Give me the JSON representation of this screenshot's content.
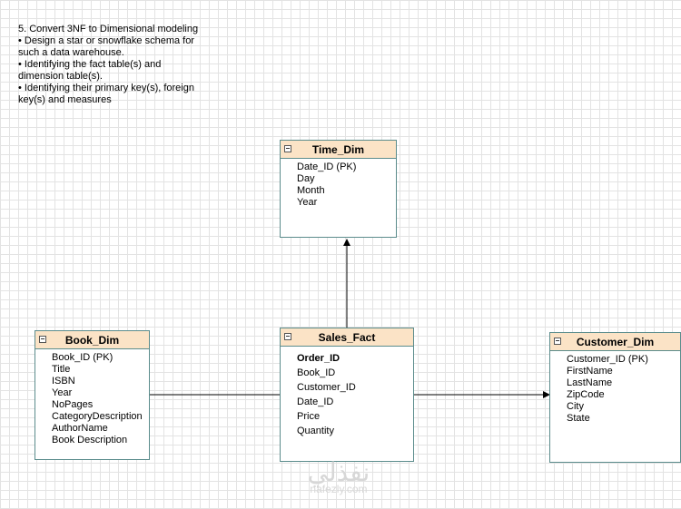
{
  "task": {
    "lines": [
      "5. Convert 3NF to Dimensional modeling",
      "• Design a star or snowflake schema for such a data warehouse.",
      "• Identifying the fact table(s) and dimension table(s).",
      "• Identifying their primary key(s), foreign key(s) and measures"
    ]
  },
  "entities": {
    "time": {
      "title": "Time_Dim",
      "attributes": [
        "Date_ID (PK)",
        "Day",
        "Month",
        "Year"
      ]
    },
    "book": {
      "title": "Book_Dim",
      "attributes": [
        "Book_ID (PK)",
        "Title",
        "ISBN",
        "Year",
        "NoPages",
        "CategoryDescription",
        "AuthorName",
        "Book Description"
      ]
    },
    "sales": {
      "title": "Sales_Fact",
      "attributes": [
        "Order_ID",
        "Book_ID",
        "Customer_ID",
        "Date_ID",
        "Price",
        "Quantity"
      ]
    },
    "customer": {
      "title": "Customer_Dim",
      "attributes": [
        "Customer_ID (PK)",
        "FirstName",
        "LastName",
        "ZipCode",
        "City",
        "State"
      ]
    }
  },
  "watermark": {
    "arabic": "نفذلي",
    "latin": "nafezly.com"
  }
}
